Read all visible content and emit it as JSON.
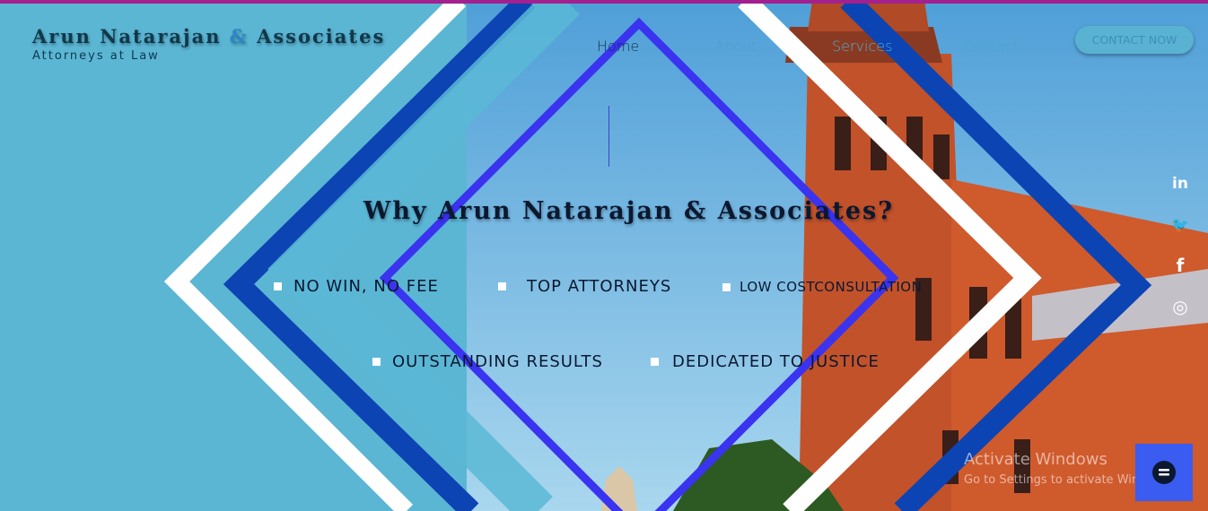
{
  "colors": {
    "top_border": "#a3218f",
    "sky": "#5bb6d4",
    "navy_stripe": "#0c44b4",
    "violet_frame": "#3a33f0",
    "brand_text": "#10384a",
    "ampersand": "#2a86c4",
    "chat_button": "#3a5cf0"
  },
  "brand": {
    "name_part1": "Arun Natarajan",
    "amp": "&",
    "name_part2": "Associates",
    "tagline": "Attorneys at Law"
  },
  "nav": {
    "items": [
      {
        "label": "Home",
        "color": "#123047"
      },
      {
        "label": "About",
        "color": "#4c9fc8"
      },
      {
        "label": "Services",
        "color": "#4eb2d2"
      },
      {
        "label": "Contact",
        "color": "#4aa6c6"
      }
    ],
    "cta_label": "CONTACT NOW"
  },
  "hero": {
    "heading": "Why Arun Natarajan & Associates?",
    "features_row1": [
      "NO WIN, NO FEE",
      "TOP ATTORNEYS",
      "LOW COSTCONSULTATION"
    ],
    "features_row2": [
      "OUTSTANDING RESULTS",
      "DEDICATED TO JUSTICE"
    ]
  },
  "social": [
    {
      "icon": "linkedin-icon",
      "glyph": "in"
    },
    {
      "icon": "twitter-icon",
      "glyph": "🐦"
    },
    {
      "icon": "facebook-icon",
      "glyph": "f"
    },
    {
      "icon": "instagram-icon",
      "glyph": "◎"
    }
  ],
  "os_watermark": {
    "title": "Activate Windows",
    "subtitle": "Go to Settings to activate Windows."
  },
  "chat": {
    "icon": "chat-icon"
  }
}
